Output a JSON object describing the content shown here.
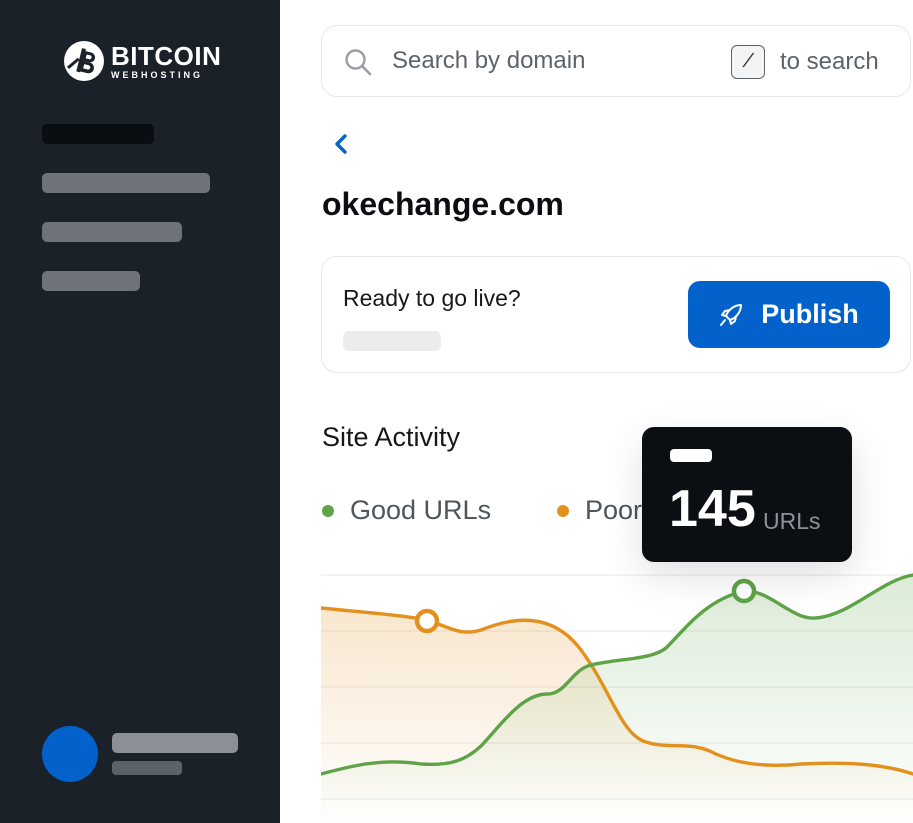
{
  "app": {
    "logo_title": "BITCOIN",
    "logo_subtitle": "WEBHOSTING"
  },
  "search": {
    "placeholder": "Search by domain",
    "shortcut_key": "/",
    "shortcut_hint": "to search"
  },
  "site": {
    "domain": "okechange.com"
  },
  "publish_card": {
    "label": "Ready to go live?",
    "button_label": "Publish"
  },
  "activity": {
    "title": "Site Activity",
    "legend": [
      {
        "label": "Good URLs",
        "color": "#5fa348"
      },
      {
        "label": "Poor",
        "color": "#e2911f"
      }
    ],
    "tooltip": {
      "value": "145",
      "unit": "URLs"
    }
  },
  "colors": {
    "sidebar_bg": "#1b2129",
    "accent": "#0361cc",
    "good": "#5fa348",
    "poor": "#e2911f"
  }
}
